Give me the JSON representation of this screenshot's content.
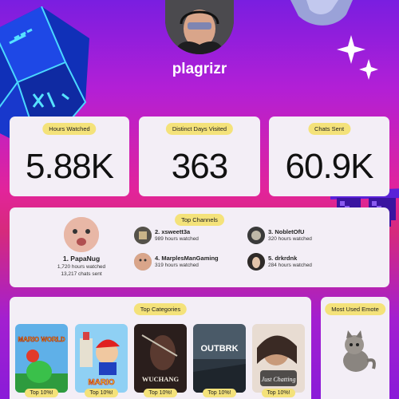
{
  "profile": {
    "username": "plagrizr"
  },
  "stats": [
    {
      "label": "Hours Watched",
      "value": "5.88K"
    },
    {
      "label": "Distinct Days Visited",
      "value": "363"
    },
    {
      "label": "Chats Sent",
      "value": "60.9K"
    }
  ],
  "top_channels": {
    "title": "Top Channels",
    "first": {
      "rank_name": "1. PapaNug",
      "hours": "1,720 hours watched",
      "chats": "13,217 chats sent"
    },
    "others": [
      {
        "rank_name": "2. xsweett3a",
        "hours": "989 hours watched"
      },
      {
        "rank_name": "3. NobletOfU",
        "hours": "320 hours watched"
      },
      {
        "rank_name": "4. MarplesManGaming",
        "hours": "319 hours watched"
      },
      {
        "rank_name": "5. drkrdnk",
        "hours": "284 hours watched"
      }
    ]
  },
  "top_categories": {
    "title": "Top Categories",
    "items": [
      {
        "name": "Super Mario World",
        "art_text": "MARIO WORLD",
        "badge": "Top 10%!"
      },
      {
        "name": "Super Mario 64",
        "art_text": "MARIO",
        "badge": "Top 10%!"
      },
      {
        "name": "Wuchang: Fallen Feathers",
        "art_text": "WUCHANG",
        "badge": "Top 10%!"
      },
      {
        "name": "Outbreak",
        "art_text": "OUTBRK",
        "badge": "Top 10%!"
      },
      {
        "name": "Just Chatting",
        "art_text": "Just Chatting",
        "badge": "Top 10%!"
      }
    ]
  },
  "emote": {
    "title": "Most Used Emote",
    "icon": "cat-emote"
  }
}
